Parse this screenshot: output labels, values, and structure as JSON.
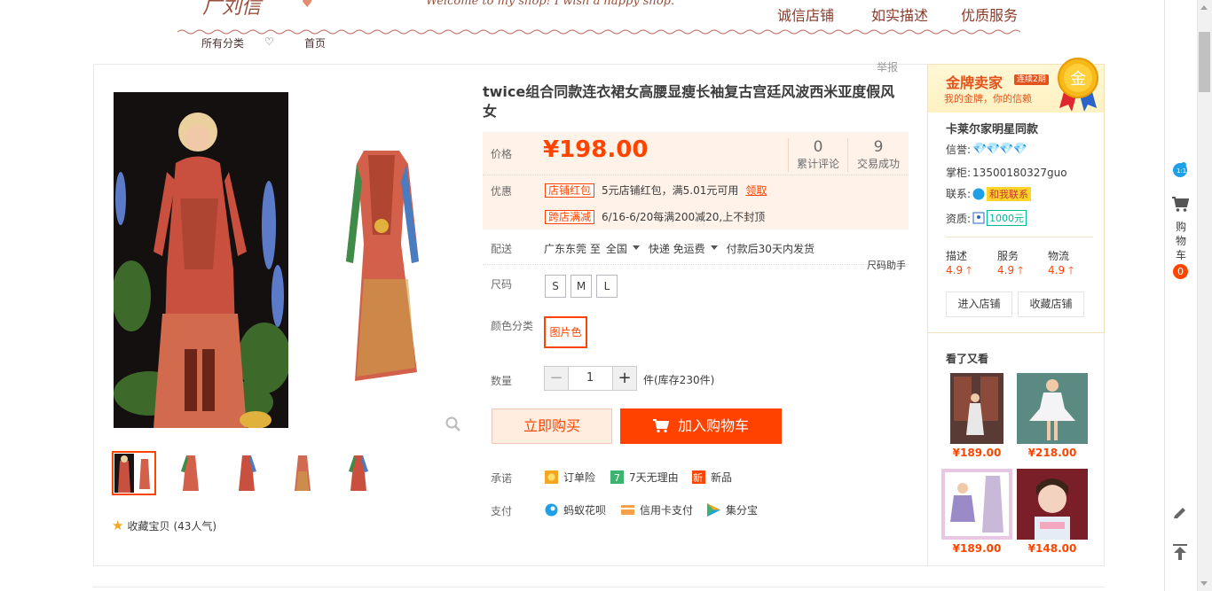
{
  "header": {
    "logo_text": "广刘信",
    "welcome": "Welcome to my shop! I wish a happy shop.",
    "promises": [
      "诚信店铺",
      "如实描述",
      "优质服务"
    ],
    "nav": [
      "所有分类",
      "♡",
      "首页"
    ]
  },
  "report_label": "举报",
  "product": {
    "title": "twice组合同款连衣裙女高腰显瘦长袖复古宫廷风波西米亚度假风女",
    "price_label": "价格",
    "price": "¥198.00",
    "reviews_count": "0",
    "reviews_label": "累计评论",
    "sales_count": "9",
    "sales_label": "交易成功",
    "discount_label": "优惠",
    "promo1_tag": "店铺红包",
    "promo1_text": "5元店铺红包，满5.01元可用",
    "promo1_link": "领取",
    "promo2_tag": "跨店满减",
    "promo2_text": "6/16-6/20每满200减20,上不封顶",
    "ship_label": "配送",
    "ship_from": "广东东莞 至",
    "ship_to": "全国",
    "ship_method": "快递 免运费",
    "ship_time": "付款后30天内发货",
    "size_helper": "尺码助手",
    "size_label": "尺码",
    "sizes": [
      "S",
      "M",
      "L"
    ],
    "color_label": "颜色分类",
    "color_option": "图片色",
    "qty_label": "数量",
    "qty_value": "1",
    "qty_minus": "−",
    "qty_plus": "+",
    "stock": "件(库存230件)",
    "buy_now": "立即购买",
    "add_cart": "加入购物车",
    "promise_label": "承诺",
    "promises": [
      "订单险",
      "7天无理由",
      "新品"
    ],
    "pay_label": "支付",
    "payments": [
      "蚂蚁花呗",
      "信用卡支付",
      "集分宝"
    ],
    "favorite": "收藏宝贝",
    "favorite_count": "(43人气)"
  },
  "seller": {
    "title": "金牌卖家",
    "badge": "连续2期",
    "subtitle": "我的金牌，你的信赖",
    "medal_text": "金",
    "shop_name": "卡莱尔家明星同款",
    "credit_label": "信誉:",
    "diamonds": "💎💎💎💎",
    "owner_label": "掌柜:",
    "owner": "13500180327guo",
    "contact_label": "联系:",
    "contact": "和我联系",
    "qual_label": "资质:",
    "qual": "1000元",
    "scores": [
      {
        "label": "描述",
        "value": "4.9"
      },
      {
        "label": "服务",
        "value": "4.9"
      },
      {
        "label": "物流",
        "value": "4.9"
      }
    ],
    "enter_shop": "进入店铺",
    "fav_shop": "收藏店铺"
  },
  "also_viewed": {
    "title": "看了又看",
    "items": [
      {
        "price": "¥189.00"
      },
      {
        "price": "¥218.00"
      },
      {
        "price": "¥189.00"
      },
      {
        "price": "¥148.00"
      }
    ]
  },
  "toolbar": {
    "cart_label": "购物车",
    "cart_count": "0"
  },
  "colors": {
    "accent": "#ff4400",
    "price_bg": "#fff2e8",
    "gold": "#e2541b"
  }
}
